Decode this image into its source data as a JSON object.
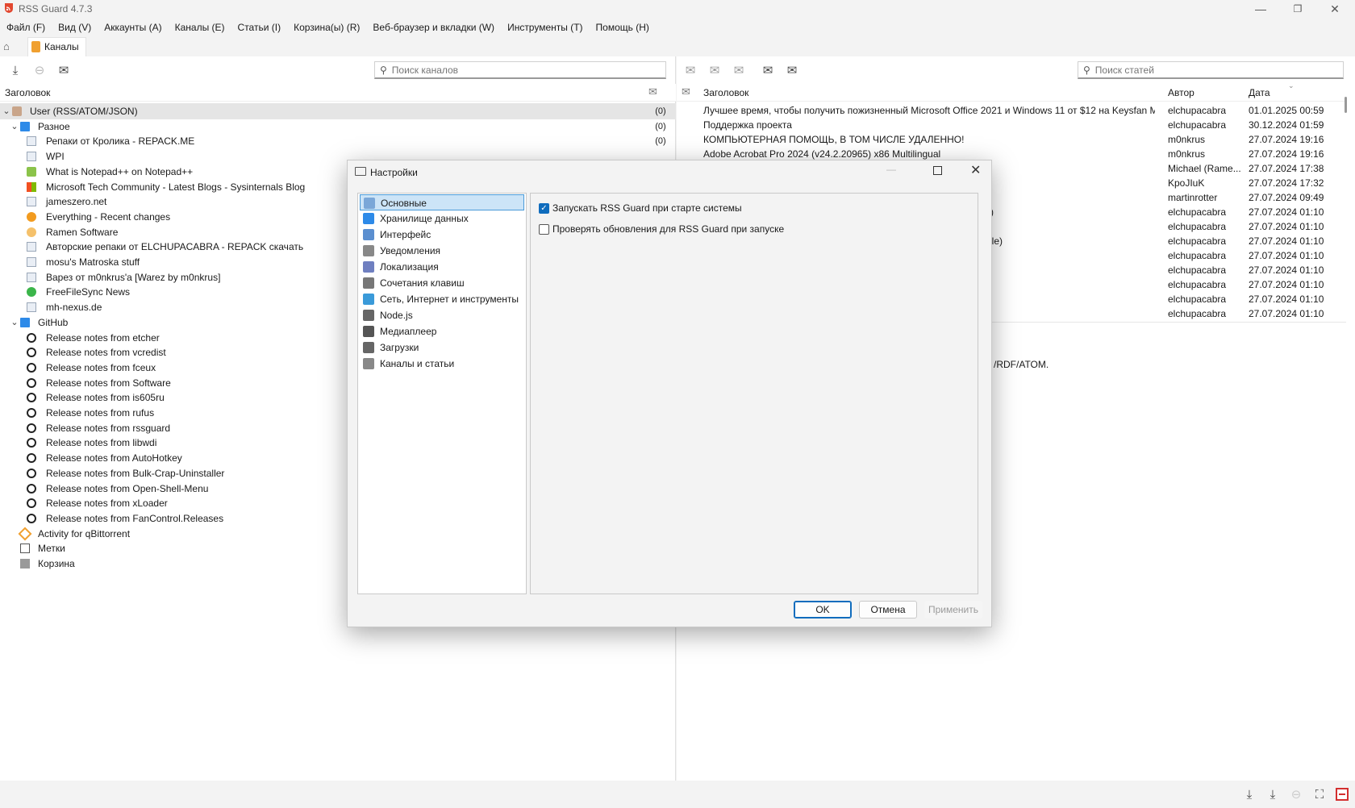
{
  "window": {
    "title": "RSS Guard 4.7.3"
  },
  "menu": [
    "Файл (F)",
    "Вид (V)",
    "Аккаунты (A)",
    "Каналы (E)",
    "Статьи (I)",
    "Корзина(ы) (R)",
    "Веб-браузер и вкладки (W)",
    "Инструменты (T)",
    "Помощь (H)"
  ],
  "tabs": {
    "feeds_tab": "Каналы"
  },
  "feeds": {
    "search_placeholder": "Поиск каналов",
    "column_header": "Заголовок",
    "tree": [
      {
        "label": "User (RSS/ATOM/JSON)",
        "count": "(0)",
        "icon": "account-icon"
      },
      {
        "label": "Разное",
        "count": "(0)",
        "icon": "folder-icon"
      },
      {
        "label": "Репаки от Кролика - REPACK.ME",
        "count": "(0)",
        "icon": "feed-icon"
      },
      {
        "label": "WPI",
        "count": "",
        "icon": "feed-icon"
      },
      {
        "label": "What is Notepad++ on Notepad++",
        "count": "",
        "icon": "notepad-icon"
      },
      {
        "label": "Microsoft Tech Community - Latest Blogs - Sysinternals Blog",
        "count": "",
        "icon": "microsoft-icon"
      },
      {
        "label": "jameszero.net",
        "count": "",
        "icon": "feed-icon"
      },
      {
        "label": "Everything - Recent changes",
        "count": "",
        "icon": "search-icon"
      },
      {
        "label": "Ramen Software",
        "count": "",
        "icon": "ramen-icon"
      },
      {
        "label": "Авторские репаки от ELCHUPACABRA - REPACK скачать",
        "count": "",
        "icon": "feed-icon"
      },
      {
        "label": "mosu's Matroska stuff",
        "count": "",
        "icon": "feed-icon"
      },
      {
        "label": "Варез от m0nkrus'a [Warez by m0nkrus]",
        "count": "",
        "icon": "feed-icon"
      },
      {
        "label": "FreeFileSync News",
        "count": "",
        "icon": "sync-icon"
      },
      {
        "label": "mh-nexus.de",
        "count": "",
        "icon": "feed-icon"
      },
      {
        "label": "GitHub",
        "count": "",
        "icon": "folder-icon"
      },
      {
        "label": "Release notes from etcher",
        "count": "",
        "icon": "github-icon"
      },
      {
        "label": "Release notes from vcredist",
        "count": "",
        "icon": "github-icon"
      },
      {
        "label": "Release notes from fceux",
        "count": "",
        "icon": "github-icon"
      },
      {
        "label": "Release notes from Software",
        "count": "",
        "icon": "github-icon"
      },
      {
        "label": "Release notes from is605ru",
        "count": "",
        "icon": "github-icon"
      },
      {
        "label": "Release notes from rufus",
        "count": "",
        "icon": "github-icon"
      },
      {
        "label": "Release notes from rssguard",
        "count": "",
        "icon": "github-icon"
      },
      {
        "label": "Release notes from libwdi",
        "count": "",
        "icon": "github-icon"
      },
      {
        "label": "Release notes from AutoHotkey",
        "count": "",
        "icon": "github-icon"
      },
      {
        "label": "Release notes from Bulk-Crap-Uninstaller",
        "count": "",
        "icon": "github-icon"
      },
      {
        "label": "Release notes from Open-Shell-Menu",
        "count": "",
        "icon": "github-icon"
      },
      {
        "label": "Release notes from xLoader",
        "count": "",
        "icon": "github-icon"
      },
      {
        "label": "Release notes from FanControl.Releases",
        "count": "",
        "icon": "github-icon"
      },
      {
        "label": "Activity for qBittorrent",
        "count": "",
        "icon": "qbittorrent-icon"
      },
      {
        "label": "Метки",
        "count": "",
        "icon": "tag-icon"
      },
      {
        "label": "Корзина",
        "count": "",
        "icon": "trash-icon"
      }
    ]
  },
  "articles": {
    "search_placeholder": "Поиск статей",
    "columns": {
      "title": "Заголовок",
      "author": "Автор",
      "date": "Дата"
    },
    "rows": [
      {
        "title": "Лучшее время, чтобы получить пожизненный Microsoft Office 2021 и Windows 11 от $12 на Keysfan M...",
        "author": "elchupacabra",
        "date": "01.01.2025 00:59"
      },
      {
        "title": "Поддержка проекта",
        "author": "elchupacabra",
        "date": "30.12.2024 01:59"
      },
      {
        "title": "КОМПЬЮТЕРНАЯ ПОМОЩЬ, В ТОМ ЧИСЛЕ УДАЛЕННО!",
        "author": "m0nkrus",
        "date": "27.07.2024 19:16"
      },
      {
        "title": "Adobe Acrobat Pro 2024 (v24.2.20965) x86 Multilingual",
        "author": "m0nkrus",
        "date": "27.07.2024 19:16"
      },
      {
        "title": "",
        "author": "Michael (Rame...",
        "date": "27.07.2024 17:38"
      },
      {
        "title": "",
        "author": "KpoJIuK",
        "date": "27.07.2024 17:32"
      },
      {
        "title": "",
        "author": "martinrotter",
        "date": "27.07.2024 09:49"
      },
      {
        "title": ")",
        "author": "elchupacabra",
        "date": "27.07.2024 01:10"
      },
      {
        "title": "",
        "author": "elchupacabra",
        "date": "27.07.2024 01:10"
      },
      {
        "title": "ble)",
        "author": "elchupacabra",
        "date": "27.07.2024 01:10"
      },
      {
        "title": "",
        "author": "elchupacabra",
        "date": "27.07.2024 01:10"
      },
      {
        "title": "",
        "author": "elchupacabra",
        "date": "27.07.2024 01:10"
      },
      {
        "title": "",
        "author": "elchupacabra",
        "date": "27.07.2024 01:10"
      },
      {
        "title": "",
        "author": "elchupacabra",
        "date": "27.07.2024 01:10"
      },
      {
        "title": "",
        "author": "elchupacabra",
        "date": "27.07.2024 01:10"
      }
    ],
    "preview_fragment": "/RDF/ATOM."
  },
  "dialog": {
    "title": "Настройки",
    "nav": [
      {
        "label": "Основные",
        "icon": "general-icon",
        "selected": true
      },
      {
        "label": "Хранилище данных",
        "icon": "database-icon"
      },
      {
        "label": "Интерфейс",
        "icon": "interface-icon"
      },
      {
        "label": "Уведомления",
        "icon": "bell-icon"
      },
      {
        "label": "Локализация",
        "icon": "language-icon"
      },
      {
        "label": "Сочетания клавиш",
        "icon": "keyboard-icon"
      },
      {
        "label": "Сеть, Интернет и инструменты",
        "icon": "globe-icon"
      },
      {
        "label": "Node.js",
        "icon": "nodejs-icon"
      },
      {
        "label": "Медиаплеер",
        "icon": "media-icon"
      },
      {
        "label": "Загрузки",
        "icon": "download-icon"
      },
      {
        "label": "Каналы и статьи",
        "icon": "mail-icon"
      }
    ],
    "options": [
      {
        "label": "Запускать RSS Guard при старте системы",
        "checked": true
      },
      {
        "label": "Проверять обновления для RSS Guard при запуске",
        "checked": false
      }
    ],
    "buttons": {
      "ok": "OK",
      "cancel": "Отмена",
      "apply": "Применить"
    }
  }
}
